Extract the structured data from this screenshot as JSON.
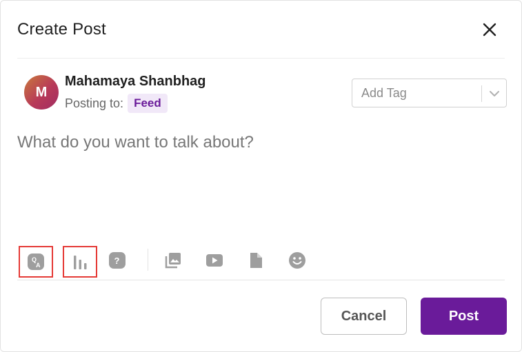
{
  "modal": {
    "title": "Create Post",
    "close_icon": "close-icon"
  },
  "author": {
    "initial": "M",
    "name": "Mahamaya Shanbhag",
    "posting_label": "Posting to:",
    "destination": "Feed"
  },
  "tag_select": {
    "placeholder": "Add Tag",
    "icon": "chevron-down-icon"
  },
  "composer": {
    "placeholder": "What do you want to talk about?",
    "value": ""
  },
  "toolbar": {
    "tools": [
      {
        "name": "qa-icon",
        "highlighted": true
      },
      {
        "name": "poll-icon",
        "highlighted": true
      },
      {
        "name": "question-icon",
        "highlighted": false
      },
      {
        "name": "image-gallery-icon",
        "highlighted": false
      },
      {
        "name": "video-icon",
        "highlighted": false
      },
      {
        "name": "document-icon",
        "highlighted": false
      },
      {
        "name": "emoji-icon",
        "highlighted": false
      }
    ]
  },
  "actions": {
    "cancel_label": "Cancel",
    "post_label": "Post"
  },
  "colors": {
    "accent": "#6a1b9a",
    "badge_bg": "#f1e8f8",
    "highlight": "#e53935",
    "icon_gray": "#9e9e9e"
  }
}
